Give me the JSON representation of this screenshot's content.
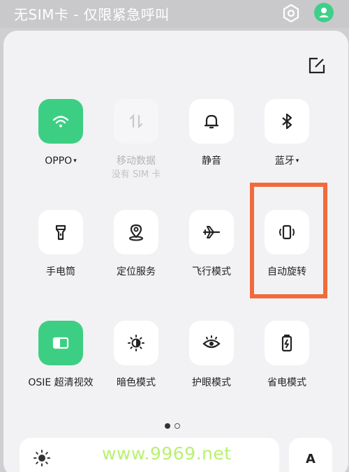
{
  "status_bar": {
    "text": "无SIM卡 - 仅限紧急呼叫",
    "icons": [
      "settings-icon",
      "user-avatar-icon"
    ]
  },
  "panel": {
    "edit_icon": "edit-icon",
    "tiles": [
      {
        "label": "OPPO",
        "caret": "▾",
        "icon": "wifi-icon",
        "state": "on"
      },
      {
        "label": "移动数据",
        "sub": "没有 SIM 卡",
        "icon": "mobile-data-icon",
        "state": "disabled"
      },
      {
        "label": "静音",
        "icon": "bell-icon",
        "state": "off"
      },
      {
        "label": "蓝牙",
        "caret": "▾",
        "icon": "bluetooth-icon",
        "state": "off"
      },
      {
        "label": "手电筒",
        "icon": "flashlight-icon",
        "state": "off"
      },
      {
        "label": "定位服务",
        "icon": "location-icon",
        "state": "off"
      },
      {
        "label": "飞行模式",
        "icon": "airplane-icon",
        "state": "off"
      },
      {
        "label": "自动旋转",
        "icon": "rotate-icon",
        "state": "off",
        "highlighted": true
      },
      {
        "label": "OSIE 超清视效",
        "icon": "display-enhance-icon",
        "state": "on"
      },
      {
        "label": "暗色模式",
        "icon": "dark-mode-icon",
        "state": "off"
      },
      {
        "label": "护眼模式",
        "icon": "eye-icon",
        "state": "off"
      },
      {
        "label": "省电模式",
        "icon": "battery-icon",
        "state": "off"
      }
    ],
    "page_indicator": {
      "current": 1,
      "total": 2
    },
    "brightness": {
      "icon": "sun-icon"
    },
    "auto_button": "A"
  },
  "watermark": "www.9969.net",
  "colors": {
    "active_tile": "#3ccf83",
    "highlight_border": "#f26a3b",
    "panel_bg": "#f2f2f4"
  }
}
